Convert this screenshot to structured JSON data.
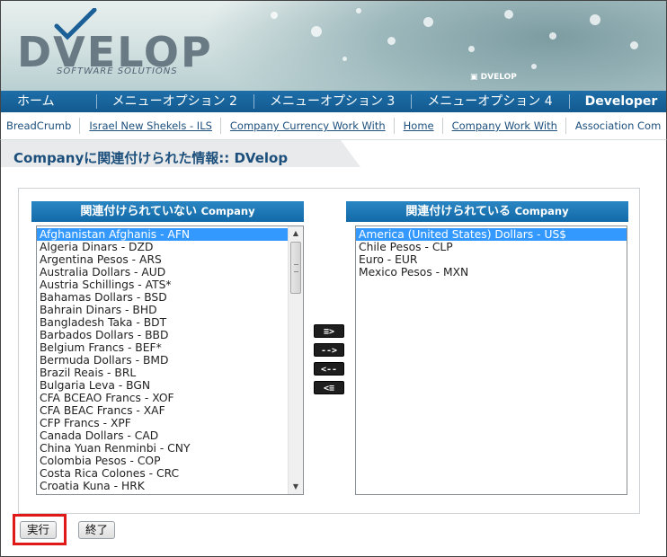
{
  "brand": {
    "logo_text": "DVELOP",
    "tagline": "SOFTWARE SOLUTIONS",
    "small_logo": "DVELOP"
  },
  "nav": {
    "items": [
      "ホーム",
      "メニューオプション 2",
      "メニューオプション 3",
      "メニューオプション 4",
      "Developer"
    ]
  },
  "breadcrumb": {
    "root": "BreadCrumb",
    "items": [
      "Israel New Shekels - ILS",
      "Company Currency Work With",
      "Home",
      "Company Work With",
      "Association Com"
    ]
  },
  "page": {
    "title": "Companyに関連付けられた情報:: DVelop"
  },
  "left_list": {
    "header_jp": "関連付けられていない",
    "header_en": "Company",
    "selected_index": 0,
    "options": [
      "Afghanistan Afghanis - AFN",
      "Algeria Dinars - DZD",
      "Argentina Pesos - ARS",
      "Australia Dollars - AUD",
      "Austria Schillings - ATS*",
      "Bahamas Dollars - BSD",
      "Bahrain Dinars - BHD",
      "Bangladesh Taka - BDT",
      "Barbados Dollars - BBD",
      "Belgium Francs - BEF*",
      "Bermuda Dollars - BMD",
      "Brazil Reais - BRL",
      "Bulgaria Leva - BGN",
      "CFA BCEAO Francs - XOF",
      "CFA BEAC Francs - XAF",
      "CFP Francs - XPF",
      "Canada Dollars - CAD",
      "China Yuan Renminbi - CNY",
      "Colombia Pesos - COP",
      "Costa Rica Colones - CRC",
      "Croatia Kuna - HRK"
    ]
  },
  "right_list": {
    "header_jp": "関連付けられている",
    "header_en": "Company",
    "selected_index": 0,
    "options": [
      "America (United States) Dollars - US$",
      "Chile Pesos - CLP",
      "Euro - EUR",
      "Mexico Pesos - MXN"
    ]
  },
  "transfer_buttons": {
    "add_all": "≡>",
    "add": "-->",
    "remove": "<--",
    "remove_all": "<≡"
  },
  "actions": {
    "run_label": "実行",
    "exit_label": "終了"
  },
  "colors": {
    "nav_blue": "#125a90",
    "header_blue": "#1a78b8",
    "selection": "#3399ff",
    "title_text": "#1c4f7c",
    "highlight_red": "#e01818"
  }
}
